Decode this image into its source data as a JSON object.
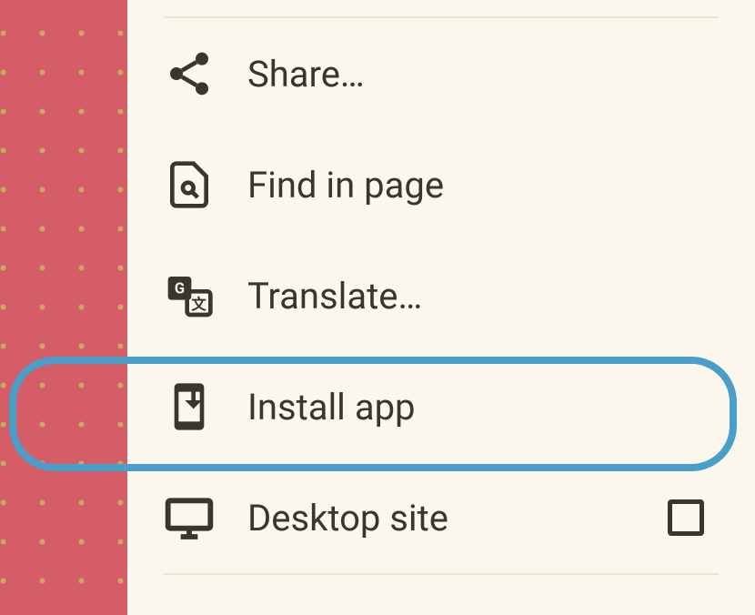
{
  "menu": {
    "items": [
      {
        "label": "Share…",
        "icon": "share-icon"
      },
      {
        "label": "Find in page",
        "icon": "find-in-page-icon"
      },
      {
        "label": "Translate…",
        "icon": "translate-icon"
      },
      {
        "label": "Install app",
        "icon": "install-app-icon",
        "highlighted": true
      },
      {
        "label": "Desktop site",
        "icon": "desktop-icon",
        "has_checkbox": true,
        "checked": false
      }
    ]
  },
  "colors": {
    "background": "#d45d68",
    "dots": "#c9a95f",
    "panel": "#fcf7ed",
    "text": "#3a362c",
    "highlight": "#4a9fc9",
    "divider": "#ebe4d6"
  }
}
